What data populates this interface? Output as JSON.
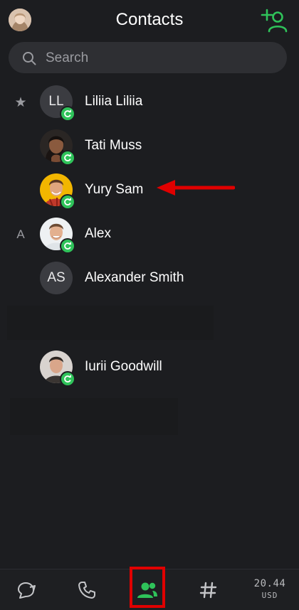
{
  "header": {
    "title": "Contacts"
  },
  "search": {
    "placeholder": "Search"
  },
  "contacts": [
    {
      "section": "★",
      "name": "Liliia Liliia",
      "initials": "LL",
      "online": true
    },
    {
      "section": "",
      "name": "Tati Muss",
      "initials": "",
      "online": true
    },
    {
      "section": "",
      "name": "Yury Sam",
      "initials": "",
      "online": true
    },
    {
      "section": "A",
      "name": "Alex",
      "initials": "",
      "online": true
    },
    {
      "section": "",
      "name": "Alexander Smith",
      "initials": "AS",
      "online": false
    },
    {
      "section": "",
      "name": "Iurii Goodwill",
      "initials": "",
      "online": true
    }
  ],
  "bottom_nav": {
    "items": [
      "chats-icon",
      "phone-icon",
      "contacts-icon",
      "dialpad-hash-icon"
    ],
    "active": "contacts-icon",
    "balance_amount": "20.44",
    "balance_currency": "USD"
  },
  "colors": {
    "background": "#1c1d20",
    "accent": "#2fc35a",
    "annotation": "#e00000"
  }
}
